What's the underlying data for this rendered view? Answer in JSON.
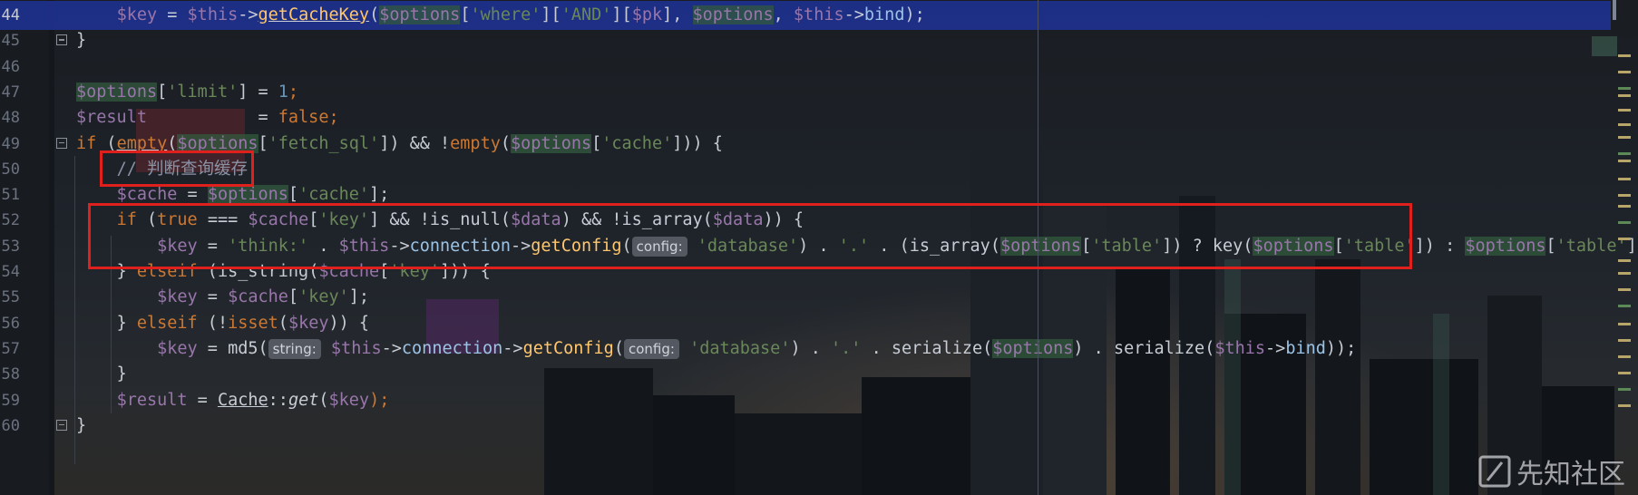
{
  "editor": {
    "lines": [
      {
        "n": "44",
        "current": true,
        "parts": [
          {
            "t": "    ",
            "c": ""
          },
          {
            "t": "$key",
            "c": "v"
          },
          {
            "t": " = ",
            "c": ""
          },
          {
            "t": "$this",
            "c": "v"
          },
          {
            "t": "->",
            "c": ""
          },
          {
            "t": "getCacheKey",
            "c": "f u"
          },
          {
            "t": "(",
            "c": ""
          },
          {
            "t": "$options",
            "c": "v hl"
          },
          {
            "t": "[",
            "c": ""
          },
          {
            "t": "'where'",
            "c": "s"
          },
          {
            "t": "][",
            "c": ""
          },
          {
            "t": "'AND'",
            "c": "s"
          },
          {
            "t": "][",
            "c": ""
          },
          {
            "t": "$pk",
            "c": "v"
          },
          {
            "t": "], ",
            "c": ""
          },
          {
            "t": "$options",
            "c": "v hl"
          },
          {
            "t": ", ",
            "c": ""
          },
          {
            "t": "$this",
            "c": "v"
          },
          {
            "t": "->",
            "c": ""
          },
          {
            "t": "bind",
            "c": "m"
          },
          {
            "t": ");",
            "c": ""
          }
        ]
      },
      {
        "n": "45",
        "parts": [
          {
            "t": "}",
            "c": ""
          }
        ]
      },
      {
        "n": "46",
        "parts": []
      },
      {
        "n": "47",
        "parts": [
          {
            "t": "$options",
            "c": "v hl"
          },
          {
            "t": "[",
            "c": ""
          },
          {
            "t": "'limit'",
            "c": "s"
          },
          {
            "t": "] = ",
            "c": ""
          },
          {
            "t": "1",
            "c": "n"
          },
          {
            "t": ";",
            "c": "k"
          }
        ]
      },
      {
        "n": "48",
        "parts": [
          {
            "t": "$result",
            "c": "v"
          },
          {
            "t": "           = ",
            "c": ""
          },
          {
            "t": "false",
            "c": "k"
          },
          {
            "t": ";",
            "c": "k"
          }
        ]
      },
      {
        "n": "49",
        "parts": [
          {
            "t": "if",
            "c": "k"
          },
          {
            "t": " (",
            "c": ""
          },
          {
            "t": "empty",
            "c": "k u"
          },
          {
            "t": "(",
            "c": ""
          },
          {
            "t": "$options",
            "c": "v hl"
          },
          {
            "t": "[",
            "c": ""
          },
          {
            "t": "'fetch_sql'",
            "c": "s"
          },
          {
            "t": "]) && !",
            "c": ""
          },
          {
            "t": "empty",
            "c": "k"
          },
          {
            "t": "(",
            "c": ""
          },
          {
            "t": "$options",
            "c": "v hl"
          },
          {
            "t": "[",
            "c": ""
          },
          {
            "t": "'cache'",
            "c": "s"
          },
          {
            "t": "])) {",
            "c": ""
          }
        ]
      },
      {
        "n": "50",
        "parts": [
          {
            "t": "    ",
            "c": ""
          },
          {
            "t": "// 判断查询缓存",
            "c": "c"
          }
        ]
      },
      {
        "n": "51",
        "parts": [
          {
            "t": "    ",
            "c": ""
          },
          {
            "t": "$cache",
            "c": "v"
          },
          {
            "t": " = ",
            "c": ""
          },
          {
            "t": "$options",
            "c": "v hl"
          },
          {
            "t": "[",
            "c": ""
          },
          {
            "t": "'cache'",
            "c": "s"
          },
          {
            "t": "];",
            "c": ""
          }
        ]
      },
      {
        "n": "52",
        "parts": [
          {
            "t": "    ",
            "c": ""
          },
          {
            "t": "if",
            "c": "k"
          },
          {
            "t": " (",
            "c": ""
          },
          {
            "t": "true",
            "c": "k"
          },
          {
            "t": " === ",
            "c": ""
          },
          {
            "t": "$cache",
            "c": "v"
          },
          {
            "t": "[",
            "c": ""
          },
          {
            "t": "'key'",
            "c": "s"
          },
          {
            "t": "] && !",
            "c": ""
          },
          {
            "t": "is_null",
            "c": ""
          },
          {
            "t": "(",
            "c": ""
          },
          {
            "t": "$data",
            "c": "v"
          },
          {
            "t": ") && !",
            "c": ""
          },
          {
            "t": "is_array",
            "c": ""
          },
          {
            "t": "(",
            "c": ""
          },
          {
            "t": "$data",
            "c": "v"
          },
          {
            "t": ")) {",
            "c": ""
          }
        ]
      },
      {
        "n": "53",
        "parts": [
          {
            "t": "        ",
            "c": ""
          },
          {
            "t": "$key",
            "c": "v"
          },
          {
            "t": " = ",
            "c": ""
          },
          {
            "t": "'think:'",
            "c": "s"
          },
          {
            "t": " . ",
            "c": ""
          },
          {
            "t": "$this",
            "c": "v"
          },
          {
            "t": "->",
            "c": ""
          },
          {
            "t": "connection",
            "c": "m"
          },
          {
            "t": "->",
            "c": ""
          },
          {
            "t": "getConfig",
            "c": "f"
          },
          {
            "t": "(",
            "c": ""
          },
          {
            "t": "config:",
            "c": "hint"
          },
          {
            "t": " ",
            "c": ""
          },
          {
            "t": "'database'",
            "c": "s"
          },
          {
            "t": ") . ",
            "c": ""
          },
          {
            "t": "'.'",
            "c": "s"
          },
          {
            "t": " . (",
            "c": ""
          },
          {
            "t": "is_array",
            "c": ""
          },
          {
            "t": "(",
            "c": ""
          },
          {
            "t": "$options",
            "c": "v hl"
          },
          {
            "t": "[",
            "c": ""
          },
          {
            "t": "'table'",
            "c": "s"
          },
          {
            "t": "]) ? ",
            "c": ""
          },
          {
            "t": "key",
            "c": ""
          },
          {
            "t": "(",
            "c": ""
          },
          {
            "t": "$options",
            "c": "v hl"
          },
          {
            "t": "[",
            "c": ""
          },
          {
            "t": "'table'",
            "c": "s"
          },
          {
            "t": "]) : ",
            "c": ""
          },
          {
            "t": "$options",
            "c": "v hl"
          },
          {
            "t": "[",
            "c": ""
          },
          {
            "t": "'table'",
            "c": "s"
          },
          {
            "t": "]",
            "c": ""
          }
        ]
      },
      {
        "n": "54",
        "parts": [
          {
            "t": "    ",
            "c": ""
          },
          {
            "t": "} ",
            "c": ""
          },
          {
            "t": "elseif",
            "c": "k"
          },
          {
            "t": " (",
            "c": ""
          },
          {
            "t": "is_string",
            "c": ""
          },
          {
            "t": "(",
            "c": ""
          },
          {
            "t": "$cache",
            "c": "v"
          },
          {
            "t": "[",
            "c": ""
          },
          {
            "t": "'key'",
            "c": "s"
          },
          {
            "t": "])) {",
            "c": ""
          }
        ]
      },
      {
        "n": "55",
        "parts": [
          {
            "t": "        ",
            "c": ""
          },
          {
            "t": "$key",
            "c": "v"
          },
          {
            "t": " = ",
            "c": ""
          },
          {
            "t": "$cache",
            "c": "v"
          },
          {
            "t": "[",
            "c": ""
          },
          {
            "t": "'key'",
            "c": "s"
          },
          {
            "t": "];",
            "c": ""
          }
        ]
      },
      {
        "n": "56",
        "parts": [
          {
            "t": "    ",
            "c": ""
          },
          {
            "t": "} ",
            "c": ""
          },
          {
            "t": "elseif",
            "c": "k"
          },
          {
            "t": " (!",
            "c": ""
          },
          {
            "t": "isset",
            "c": "k"
          },
          {
            "t": "(",
            "c": ""
          },
          {
            "t": "$key",
            "c": "v"
          },
          {
            "t": ")) {",
            "c": ""
          }
        ]
      },
      {
        "n": "57",
        "parts": [
          {
            "t": "        ",
            "c": ""
          },
          {
            "t": "$key",
            "c": "v"
          },
          {
            "t": " = ",
            "c": ""
          },
          {
            "t": "md5",
            "c": ""
          },
          {
            "t": "(",
            "c": ""
          },
          {
            "t": "string:",
            "c": "hint"
          },
          {
            "t": " ",
            "c": ""
          },
          {
            "t": "$this",
            "c": "v"
          },
          {
            "t": "->",
            "c": ""
          },
          {
            "t": "connection",
            "c": "m"
          },
          {
            "t": "->",
            "c": ""
          },
          {
            "t": "getConfig",
            "c": "f"
          },
          {
            "t": "(",
            "c": ""
          },
          {
            "t": "config:",
            "c": "hint"
          },
          {
            "t": " ",
            "c": ""
          },
          {
            "t": "'database'",
            "c": "s"
          },
          {
            "t": ") . ",
            "c": ""
          },
          {
            "t": "'.'",
            "c": "s"
          },
          {
            "t": " . ",
            "c": ""
          },
          {
            "t": "serialize",
            "c": ""
          },
          {
            "t": "(",
            "c": ""
          },
          {
            "t": "$options",
            "c": "v hl"
          },
          {
            "t": ") . ",
            "c": ""
          },
          {
            "t": "serialize",
            "c": ""
          },
          {
            "t": "(",
            "c": ""
          },
          {
            "t": "$this",
            "c": "v"
          },
          {
            "t": "->",
            "c": ""
          },
          {
            "t": "bind",
            "c": "m"
          },
          {
            "t": "));",
            "c": ""
          }
        ]
      },
      {
        "n": "58",
        "parts": [
          {
            "t": "    ",
            "c": ""
          },
          {
            "t": "}",
            "c": ""
          }
        ]
      },
      {
        "n": "59",
        "parts": [
          {
            "t": "    ",
            "c": ""
          },
          {
            "t": "$result",
            "c": "v"
          },
          {
            "t": " = ",
            "c": ""
          },
          {
            "t": "Cache",
            "c": "u"
          },
          {
            "t": "::",
            "c": ""
          },
          {
            "t": "get",
            "c": "i"
          },
          {
            "t": "(",
            "c": ""
          },
          {
            "t": "$key",
            "c": "v"
          },
          {
            "t": ");",
            "c": "k"
          }
        ]
      },
      {
        "n": "60",
        "parts": [
          {
            "t": "}",
            "c": ""
          }
        ]
      }
    ]
  },
  "watermark": {
    "text": "先知社区"
  },
  "colors": {
    "annotation": "#e0201c",
    "current_line": "#1e3296",
    "highlight": "#32593d"
  }
}
